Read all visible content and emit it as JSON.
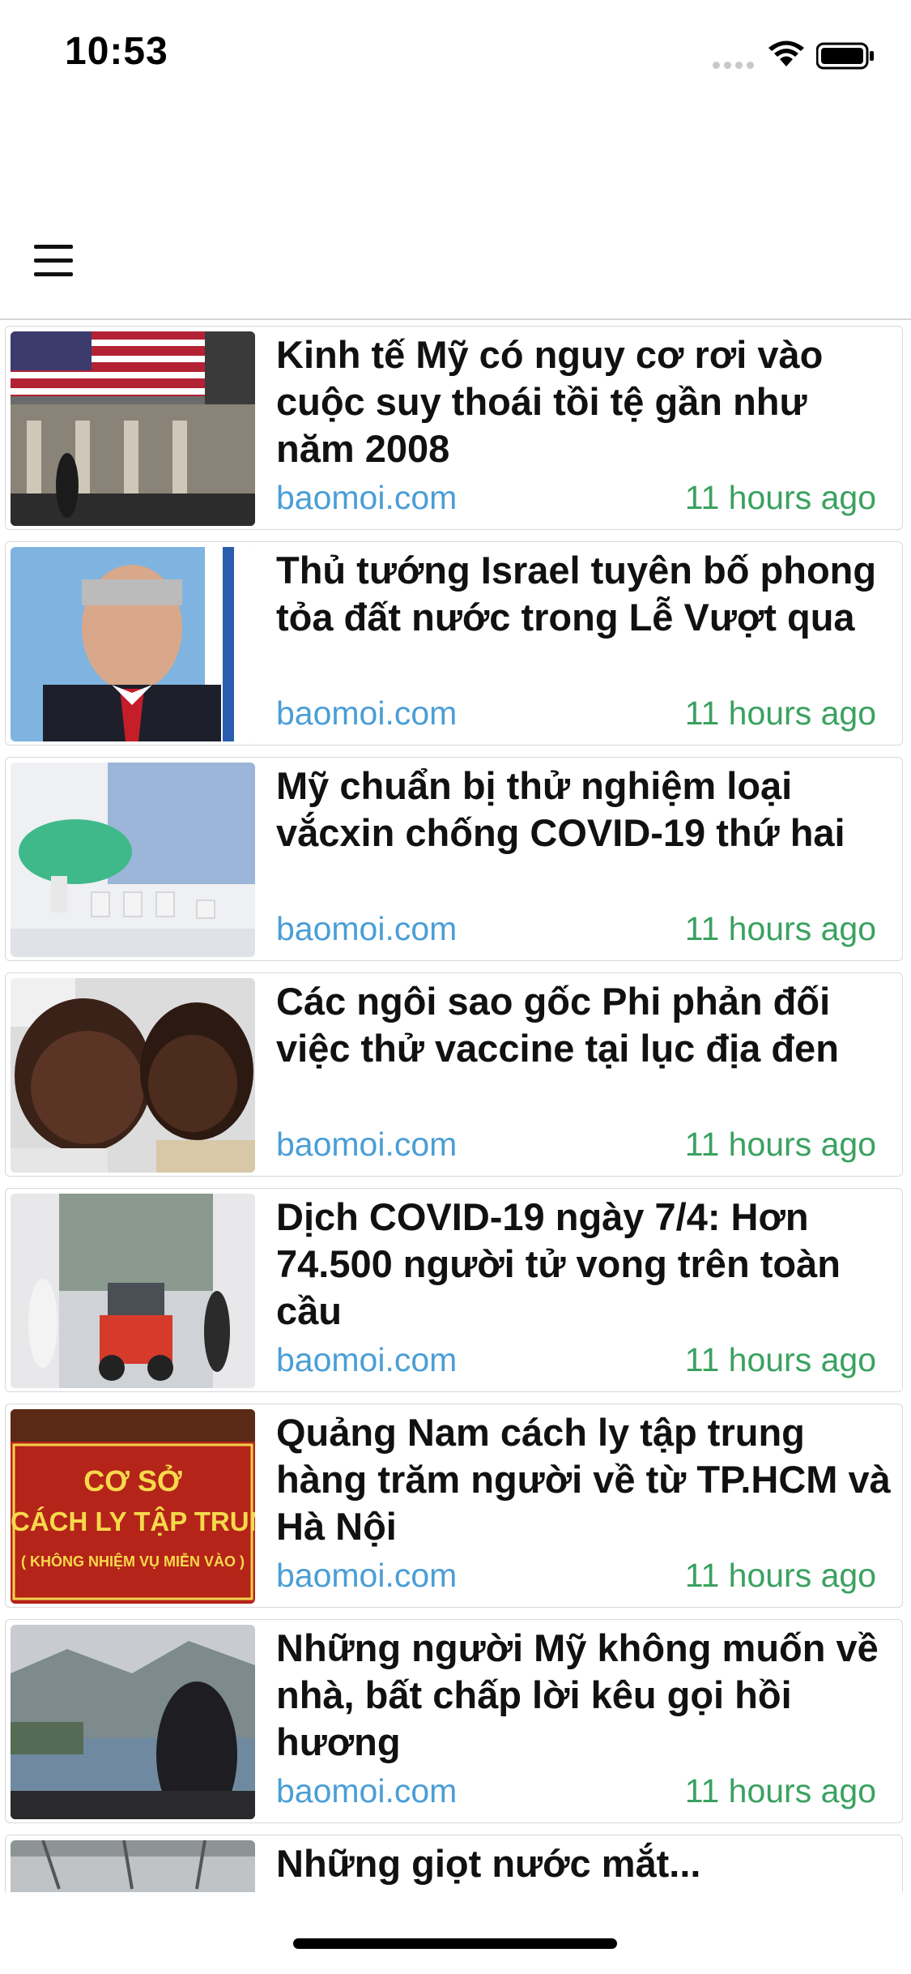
{
  "status_bar": {
    "time": "10:53"
  },
  "nav": {
    "menu_icon": "hamburger-menu-icon"
  },
  "articles": [
    {
      "title": "Kinh tế Mỹ có nguy cơ rơi vào cuộc suy thoái tồi tệ gần như năm 2008",
      "source": "baomoi.com",
      "time": "11 hours ago"
    },
    {
      "title": "Thủ tướng Israel tuyên bố phong tỏa đất nước trong Lễ Vượt qua",
      "source": "baomoi.com",
      "time": "11 hours ago"
    },
    {
      "title": "Mỹ chuẩn bị thử nghiệm loại vắcxin chống COVID-19 thứ hai",
      "source": "baomoi.com",
      "time": "11 hours ago"
    },
    {
      "title": "Các ngôi sao gốc Phi phản đối việc thử vaccine tại lục địa đen",
      "source": "baomoi.com",
      "time": "11 hours ago"
    },
    {
      "title": "Dịch COVID-19 ngày 7/4: Hơn 74.500 người tử vong trên toàn cầu",
      "source": "baomoi.com",
      "time": "11 hours ago"
    },
    {
      "title": "Quảng Nam cách ly tập trung hàng trăm người về từ TP.HCM và Hà Nội",
      "source": "baomoi.com",
      "time": "11 hours ago",
      "image_text": [
        "CƠ SỞ",
        "CÁCH LY TẬP TRUNG",
        "( KHÔNG NHIỆM VỤ MIỄN VÀO )"
      ]
    },
    {
      "title": "Những người Mỹ không muốn về nhà, bất chấp lời kêu gọi hồi hương",
      "source": "baomoi.com",
      "time": "11 hours ago"
    },
    {
      "title": "Những giọt nước mắt...",
      "source": "",
      "time": ""
    }
  ],
  "colors": {
    "source": "#4a9ed6",
    "time": "#3aa160",
    "title": "#111111"
  }
}
